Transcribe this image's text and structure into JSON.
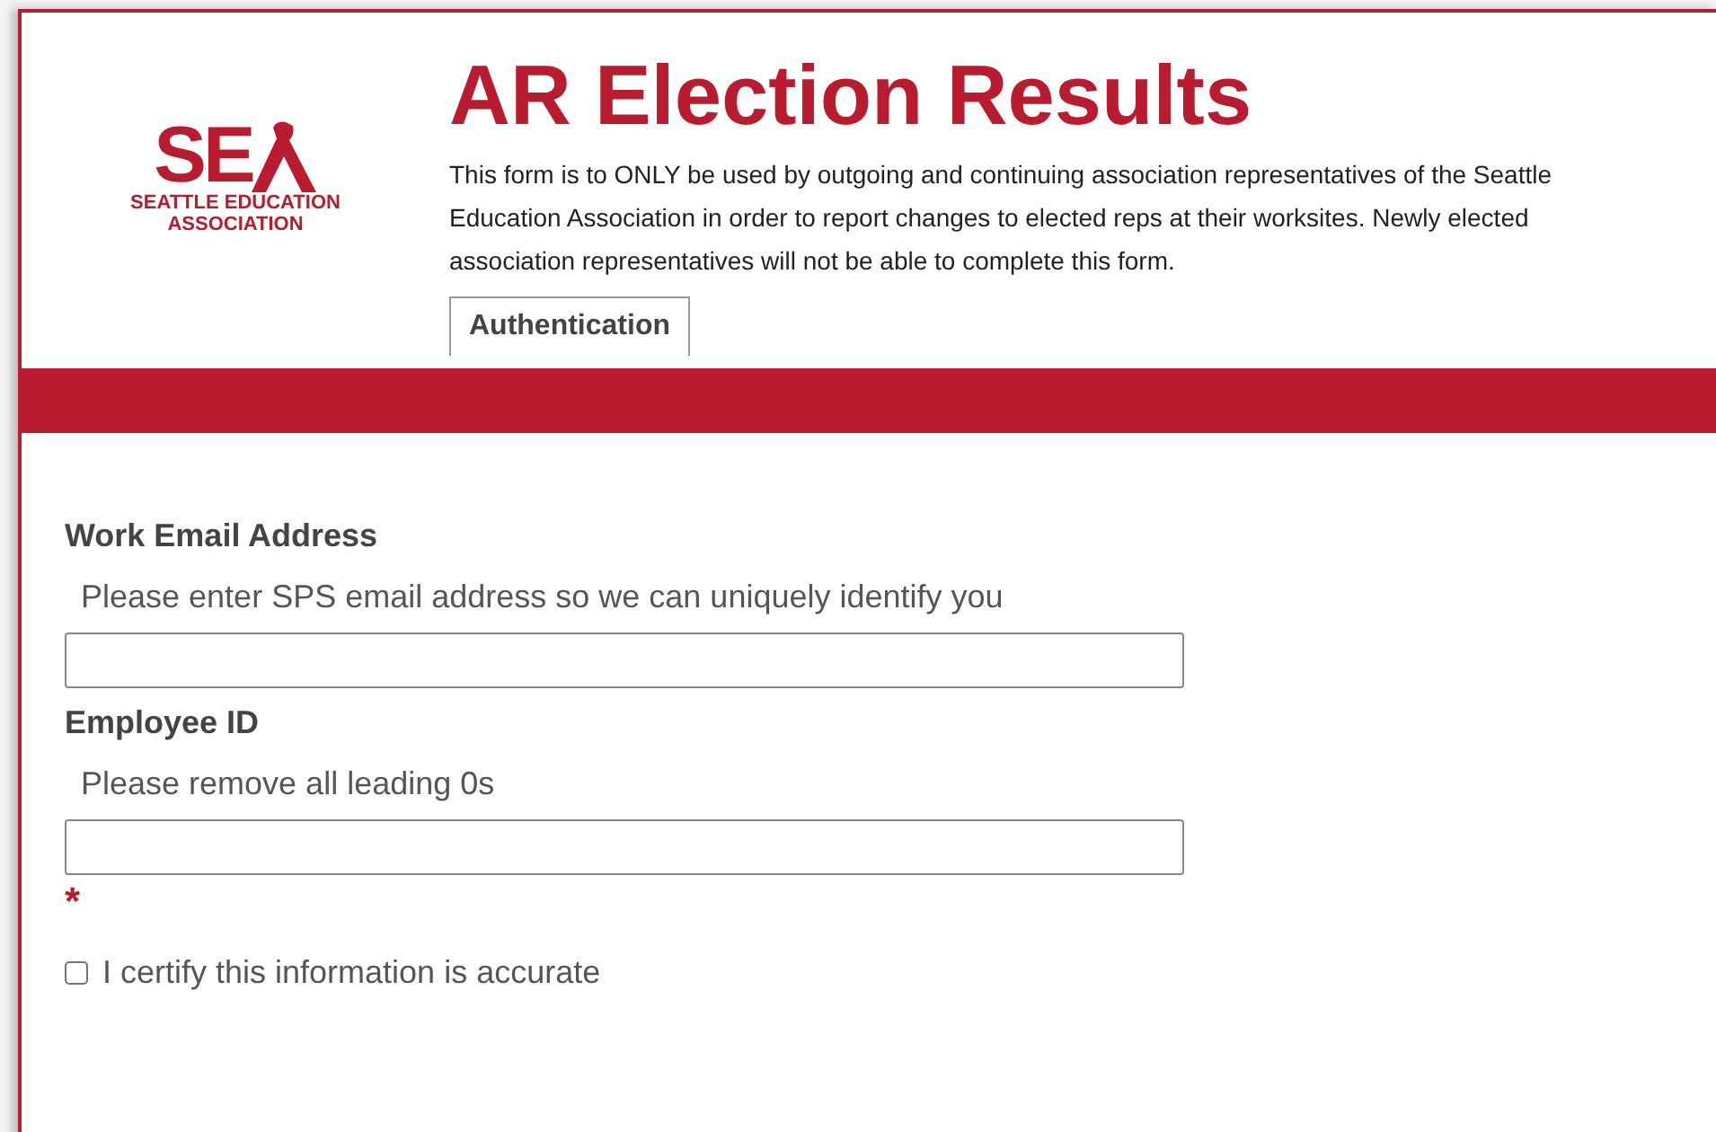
{
  "logo": {
    "mark": "SE",
    "lines": [
      "SEATTLE EDUCATION",
      "ASSOCIATION"
    ]
  },
  "title": "AR Election Results",
  "description": "This form is to ONLY be used by outgoing and continuing association representatives of the Seattle Education Association in order to report changes to elected reps at their worksites. Newly elected association representatives will not be able to complete this form.",
  "tabs": [
    {
      "label": "Authentication",
      "selected": true
    }
  ],
  "fields": [
    {
      "label": "Work Email Address",
      "hint": "Please enter SPS email address so we can uniquely identify you",
      "required": false
    },
    {
      "label": "Employee ID",
      "hint": "Please remove all leading 0s",
      "required": true
    }
  ],
  "required_mark": "*",
  "certify": {
    "label": "I certify this information is accurate",
    "checked": false
  }
}
